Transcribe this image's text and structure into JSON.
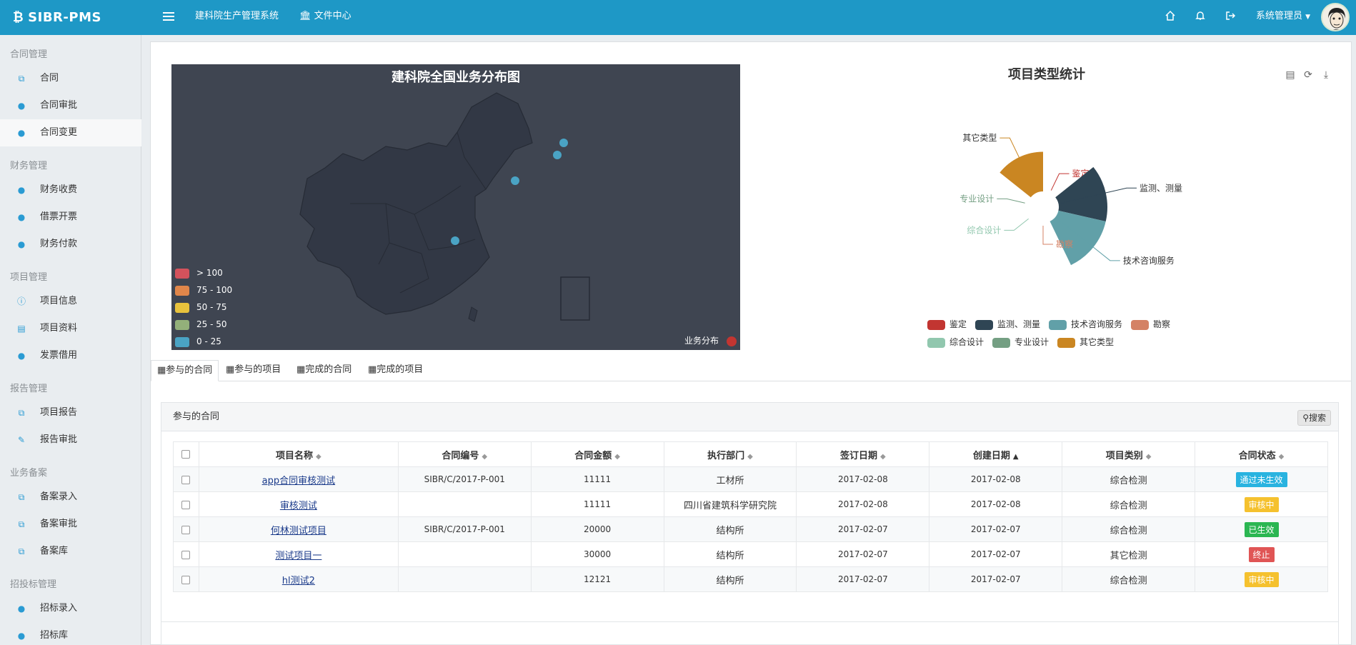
{
  "app": {
    "brand": "SIBR-PMS",
    "brand_logo": "₿"
  },
  "topbar": {
    "links": [
      {
        "label": "建科院生产管理系统"
      },
      {
        "label": "文件中心",
        "icon": "bank-icon"
      }
    ],
    "user": "系统管理员",
    "icons": [
      "home-icon",
      "bell-icon",
      "logout-icon"
    ]
  },
  "sidebar": {
    "sections": [
      {
        "title": "合同管理",
        "items": [
          {
            "label": "合同",
            "icon": "copy-icon"
          },
          {
            "label": "合同审批",
            "icon": "user-icon"
          },
          {
            "label": "合同变更",
            "icon": "user-icon",
            "active": true
          }
        ]
      },
      {
        "title": "财务管理",
        "items": [
          {
            "label": "财务收费",
            "icon": "user-icon"
          },
          {
            "label": "借票开票",
            "icon": "user-icon"
          },
          {
            "label": "财务付款",
            "icon": "user-icon"
          }
        ]
      },
      {
        "title": "项目管理",
        "items": [
          {
            "label": "项目信息",
            "icon": "info-icon"
          },
          {
            "label": "项目资料",
            "icon": "file-icon"
          },
          {
            "label": "发票借用",
            "icon": "user-icon"
          }
        ]
      },
      {
        "title": "报告管理",
        "items": [
          {
            "label": "项目报告",
            "icon": "copy-icon"
          },
          {
            "label": "报告审批",
            "icon": "pencil-icon"
          }
        ]
      },
      {
        "title": "业务备案",
        "items": [
          {
            "label": "备案录入",
            "icon": "copy-icon"
          },
          {
            "label": "备案审批",
            "icon": "copy-icon"
          },
          {
            "label": "备案库",
            "icon": "copy-icon"
          }
        ]
      },
      {
        "title": "招投标管理",
        "items": [
          {
            "label": "招标录入",
            "icon": "user-icon"
          },
          {
            "label": "招标库",
            "icon": "user-icon"
          }
        ]
      }
    ]
  },
  "map": {
    "title": "建科院全国业务分布图",
    "legend": [
      {
        "label": "> 100",
        "color": "#d4525c"
      },
      {
        "label": "75 - 100",
        "color": "#e0864a"
      },
      {
        "label": "50 - 75",
        "color": "#e8c23c"
      },
      {
        "label": "25 - 50",
        "color": "#93b07a"
      },
      {
        "label": "0 - 25",
        "color": "#4aa3c4"
      }
    ],
    "series_label": "业务分布"
  },
  "pie": {
    "title": "项目类型统计",
    "tools": [
      "data-view-icon",
      "refresh-icon",
      "download-icon"
    ]
  },
  "chart_data": {
    "type": "pie",
    "title": "项目类型统计",
    "subtype": "rose",
    "categories": [
      "鉴定",
      "监测、测量",
      "技术咨询服务",
      "勘察",
      "综合设计",
      "专业设计",
      "其它类型"
    ],
    "values": [
      0,
      3,
      3,
      0,
      0,
      0,
      2
    ],
    "colors": [
      "#c23531",
      "#2f4554",
      "#61a0a8",
      "#d48265",
      "#91c7ae",
      "#749f83",
      "#ca8622"
    ],
    "legend_position": "bottom"
  },
  "tabs": [
    {
      "label": "参与的合同",
      "active": true
    },
    {
      "label": "参与的项目"
    },
    {
      "label": "完成的合同"
    },
    {
      "label": "完成的项目"
    }
  ],
  "panel": {
    "title": "参与的合同",
    "search_label": "搜索"
  },
  "table": {
    "columns": [
      "项目名称",
      "合同编号",
      "合同金额",
      "执行部门",
      "签订日期",
      "创建日期",
      "项目类别",
      "合同状态"
    ],
    "rows": [
      {
        "name": "app合同审核测试",
        "code": "SIBR/C/2017-P-001",
        "amount": "11111",
        "dept": "工材所",
        "sign": "2017-02-08",
        "created": "2017-02-08",
        "category": "综合检测",
        "status": "通过未生效",
        "status_color": "#29b3e0"
      },
      {
        "name": "审核测试",
        "code": "",
        "amount": "11111",
        "dept": "四川省建筑科学研究院",
        "sign": "2017-02-08",
        "created": "2017-02-08",
        "category": "综合检测",
        "status": "审核中",
        "status_color": "#f5c12e"
      },
      {
        "name": "何林测试项目",
        "code": "SIBR/C/2017-P-001",
        "amount": "20000",
        "dept": "结构所",
        "sign": "2017-02-07",
        "created": "2017-02-07",
        "category": "综合检测",
        "status": "已生效",
        "status_color": "#2bb652"
      },
      {
        "name": "测试项目一",
        "code": "",
        "amount": "30000",
        "dept": "结构所",
        "sign": "2017-02-07",
        "created": "2017-02-07",
        "category": "其它检测",
        "status": "终止",
        "status_color": "#e05555"
      },
      {
        "name": "hl测试2",
        "code": "",
        "amount": "12121",
        "dept": "结构所",
        "sign": "2017-02-07",
        "created": "2017-02-07",
        "category": "综合检测",
        "status": "审核中",
        "status_color": "#f5c12e"
      }
    ]
  }
}
